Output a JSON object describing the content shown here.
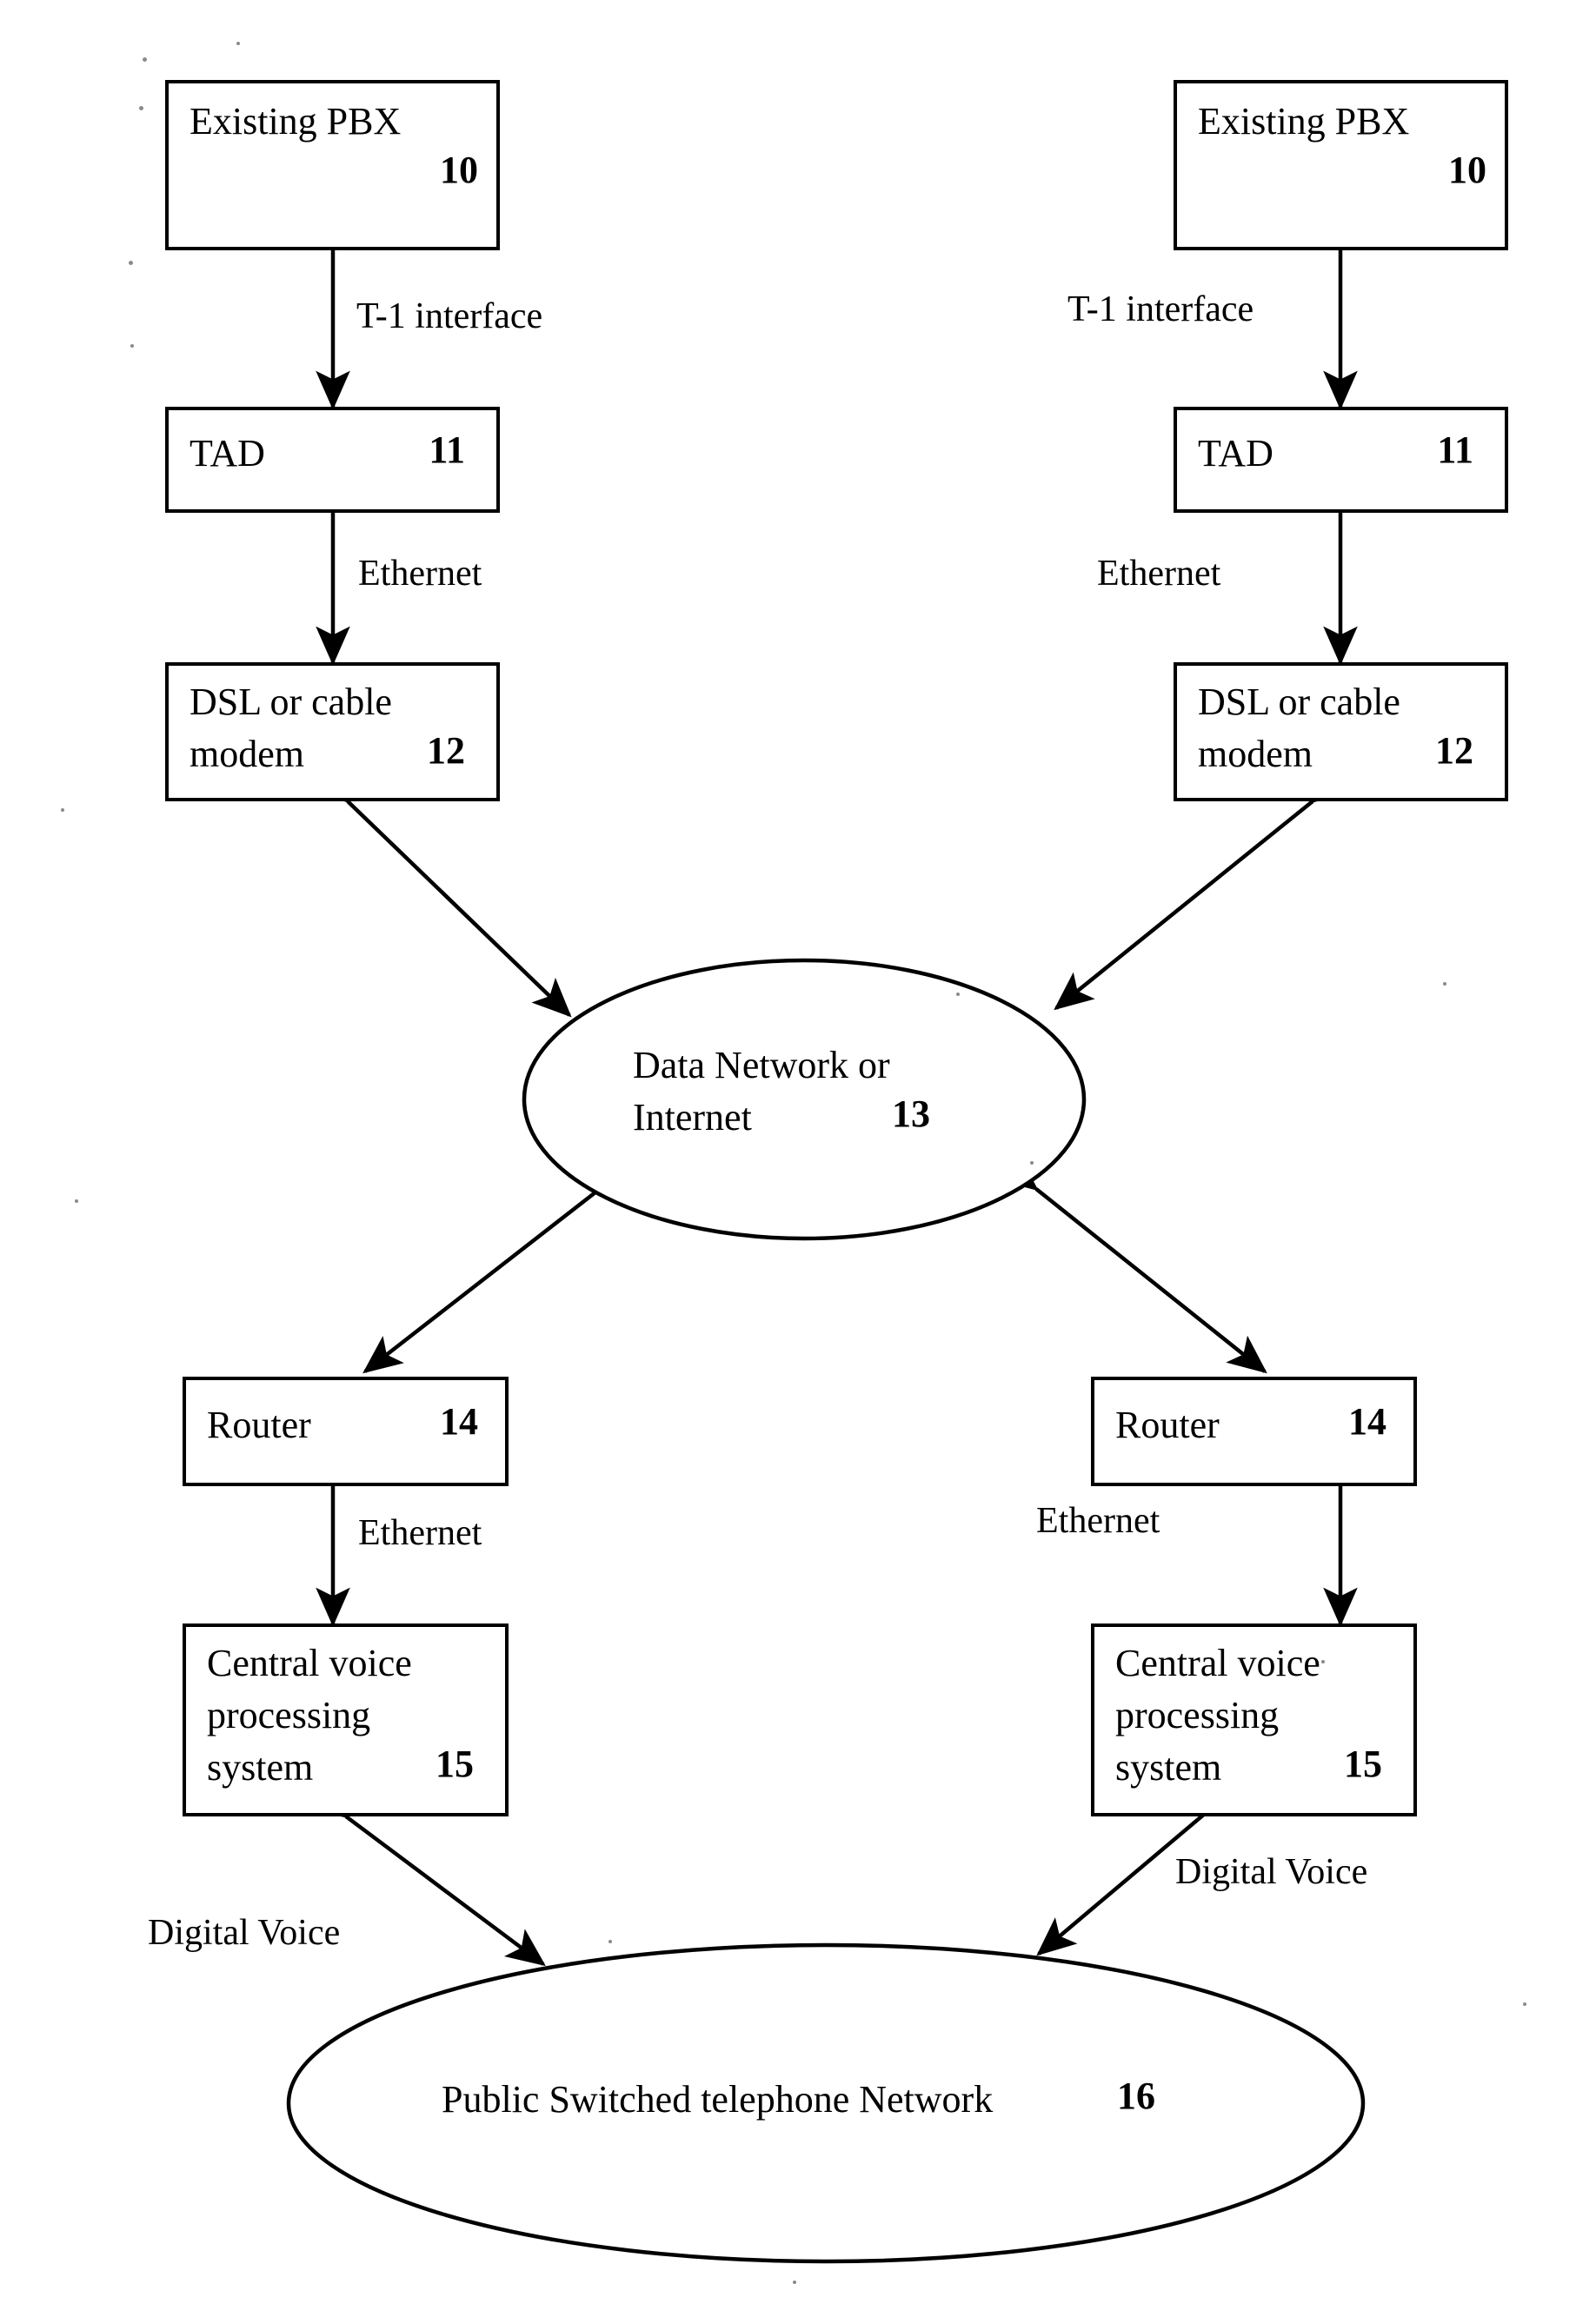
{
  "diagram": {
    "type": "network-block-diagram",
    "background_color": "#ffffff",
    "ink_color": "#000000",
    "columns": [
      "left",
      "right"
    ],
    "nodes": [
      {
        "id": "pbx-left",
        "shape": "rect",
        "label": "Existing PBX",
        "number": "10",
        "column": "left"
      },
      {
        "id": "tad-left",
        "shape": "rect",
        "label": "TAD",
        "number": "11",
        "column": "left"
      },
      {
        "id": "modem-left",
        "shape": "rect",
        "label": "DSL or cable\nmodem",
        "number": "12",
        "column": "left"
      },
      {
        "id": "network",
        "shape": "ellipse",
        "label": "Data Network or\nInternet",
        "number": "13",
        "column": "center"
      },
      {
        "id": "router-left",
        "shape": "rect",
        "label": "Router",
        "number": "14",
        "column": "left"
      },
      {
        "id": "cvps-left",
        "shape": "rect",
        "label": "Central voice\nprocessing\nsystem",
        "number": "15",
        "column": "left"
      },
      {
        "id": "pstn",
        "shape": "ellipse",
        "label": "Public Switched telephone Network",
        "number": "16",
        "column": "center"
      },
      {
        "id": "pbx-right",
        "shape": "rect",
        "label": "Existing PBX",
        "number": "10",
        "column": "right"
      },
      {
        "id": "tad-right",
        "shape": "rect",
        "label": "TAD",
        "number": "11",
        "column": "right"
      },
      {
        "id": "modem-right",
        "shape": "rect",
        "label": "DSL or cable\nmodem",
        "number": "12",
        "column": "right"
      },
      {
        "id": "router-right",
        "shape": "rect",
        "label": "Router",
        "number": "14",
        "column": "right"
      },
      {
        "id": "cvps-right",
        "shape": "rect",
        "label": "Central voice\nprocessing\nsystem",
        "number": "15",
        "column": "right"
      }
    ],
    "edge_labels": {
      "t1_left": "T-1 interface",
      "t1_right": "T-1 interface",
      "ethernet_modem_left": "Ethernet",
      "ethernet_modem_right": "Ethernet",
      "ethernet_router_left": "Ethernet",
      "ethernet_router_right": "Ethernet",
      "digital_voice_left": "Digital Voice",
      "digital_voice_right": "Digital Voice"
    },
    "connections": [
      {
        "from": "pbx-left",
        "to": "tad-left",
        "label": "T-1 interface",
        "arrow": "double",
        "orientation": "vertical"
      },
      {
        "from": "tad-left",
        "to": "modem-left",
        "label": "Ethernet",
        "arrow": "double",
        "orientation": "vertical"
      },
      {
        "from": "modem-left",
        "to": "network",
        "label": "",
        "arrow": "double",
        "orientation": "diagonal"
      },
      {
        "from": "network",
        "to": "router-left",
        "label": "",
        "arrow": "double",
        "orientation": "diagonal"
      },
      {
        "from": "router-left",
        "to": "cvps-left",
        "label": "Ethernet",
        "arrow": "double",
        "orientation": "vertical"
      },
      {
        "from": "cvps-left",
        "to": "pstn",
        "label": "Digital Voice",
        "arrow": "double",
        "orientation": "diagonal"
      },
      {
        "from": "pbx-right",
        "to": "tad-right",
        "label": "T-1 interface",
        "arrow": "double",
        "orientation": "vertical"
      },
      {
        "from": "tad-right",
        "to": "modem-right",
        "label": "Ethernet",
        "arrow": "double",
        "orientation": "vertical"
      },
      {
        "from": "modem-right",
        "to": "network",
        "label": "",
        "arrow": "double",
        "orientation": "diagonal"
      },
      {
        "from": "network",
        "to": "router-right",
        "label": "",
        "arrow": "double",
        "orientation": "diagonal"
      },
      {
        "from": "router-right",
        "to": "cvps-right",
        "label": "Ethernet",
        "arrow": "double",
        "orientation": "vertical"
      },
      {
        "from": "cvps-right",
        "to": "pstn",
        "label": "Digital Voice",
        "arrow": "double",
        "orientation": "diagonal"
      }
    ]
  }
}
